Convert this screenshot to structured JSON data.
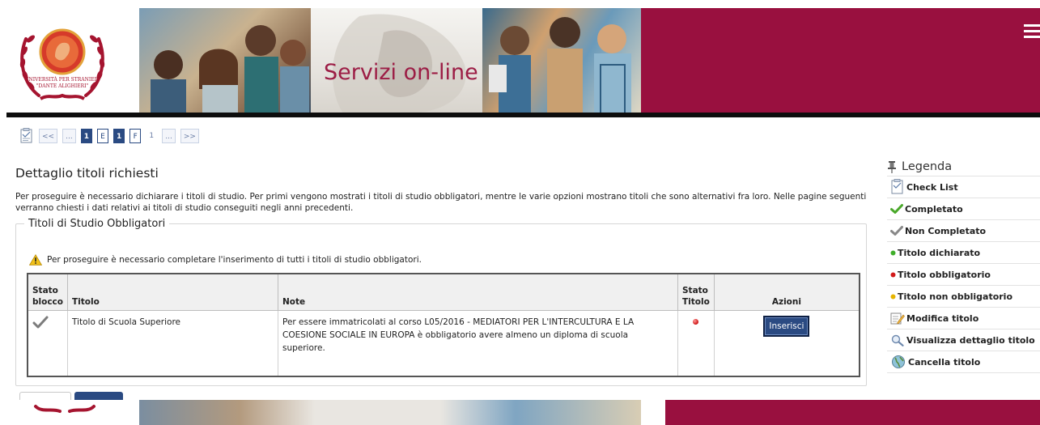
{
  "colors": {
    "brand": "#99103f",
    "accent": "#2a4a82",
    "title_red": "#9c1d45"
  },
  "header": {
    "banner_title": "Servizi on-line",
    "logo_text_line1": "UNIVERSITÀ PER STRANIERI",
    "logo_text_line2": "\"DANTE ALIGHIERI\"",
    "menu_icon": "hamburger-icon"
  },
  "pager": {
    "icon": "checklist-icon",
    "items": [
      "<<",
      "...",
      "1",
      "E",
      "1",
      "F",
      "1",
      "...",
      ">>"
    ]
  },
  "main": {
    "title": "Dettaglio titoli richiesti",
    "intro": "Per proseguire è necessario dichiarare i titoli di studio. Per primi vengono mostrati i titoli di studio obbligatori, mentre le varie opzioni mostrano titoli che sono alternativi fra loro. Nelle pagine seguenti verranno chiesti i dati relativi ai titoli di studio conseguiti negli anni precedenti.",
    "fieldset_legend": "Titoli di Studio Obbligatori",
    "warning": "Per proseguire è necessario completare l'inserimento di tutti i titoli di studio obbligatori.",
    "table": {
      "headers": {
        "stato_blocco": "Stato blocco",
        "titolo": "Titolo",
        "note": "Note",
        "stato_titolo": "Stato Titolo",
        "azioni": "Azioni"
      },
      "rows": [
        {
          "stato_blocco_icon": "check-grey-icon",
          "titolo": "Titolo di Scuola Superiore",
          "note": "Per essere immatricolati al corso L05/2016 - MEDIATORI PER L'INTERCULTURA E LA COESIONE SOCIALE IN EUROPA è obbligatorio avere almeno un diploma di scuola superiore.",
          "stato_titolo_icon": "red-dot-icon",
          "azione": "Inserisci"
        }
      ]
    }
  },
  "legend": {
    "title": "Legenda",
    "items": [
      {
        "icon": "checklist-icon",
        "label": "Check List"
      },
      {
        "icon": "check-green-icon",
        "label": "Completato"
      },
      {
        "icon": "check-grey-icon",
        "label": "Non Completato"
      },
      {
        "icon": "green-dot-icon",
        "label": "Titolo dichiarato"
      },
      {
        "icon": "red-dot-icon",
        "label": "Titolo obbligatorio"
      },
      {
        "icon": "yellow-dot-icon",
        "label": "Titolo non obbligatorio"
      },
      {
        "icon": "edit-icon",
        "label": "Modifica titolo"
      },
      {
        "icon": "magnifier-icon",
        "label": "Visualizza dettaglio titolo"
      },
      {
        "icon": "globe-delete-icon",
        "label": "Cancella titolo"
      }
    ]
  }
}
